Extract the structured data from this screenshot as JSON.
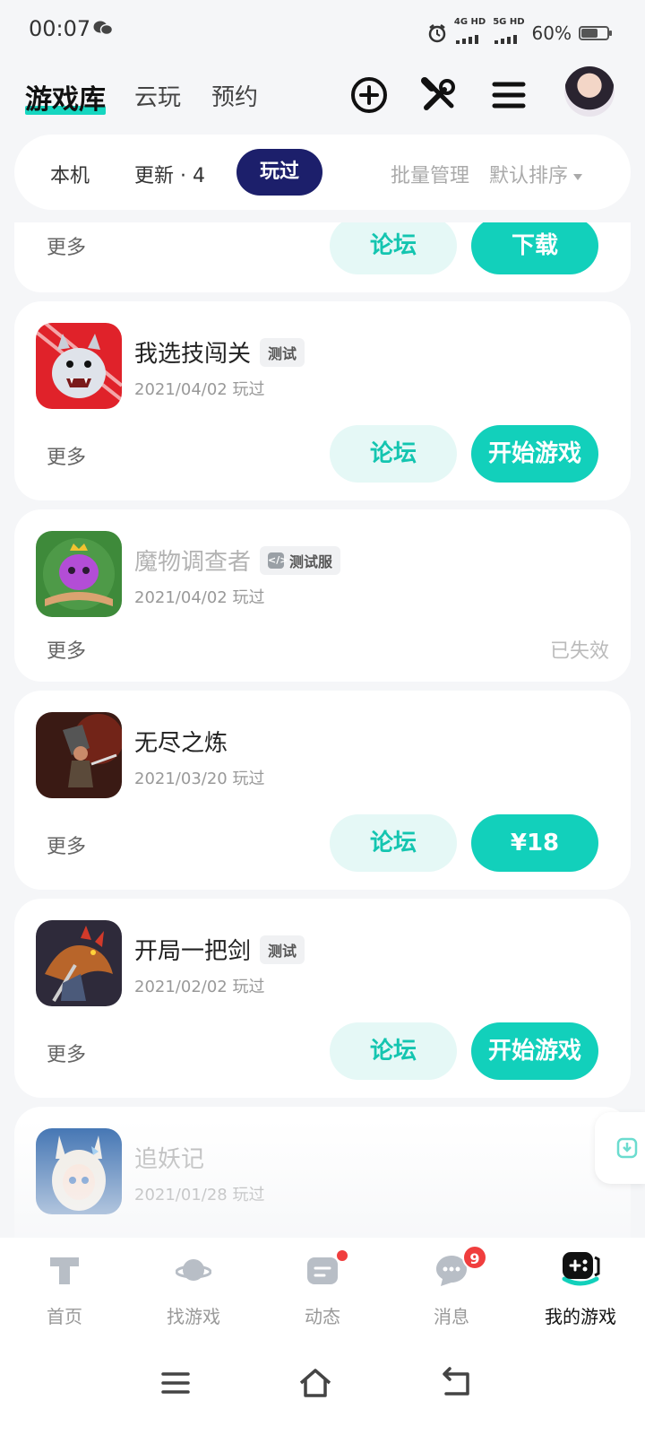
{
  "status_bar": {
    "time": "00:07",
    "net1": "4G HD",
    "net2": "5G HD",
    "battery_text": "60%",
    "battery_level": 0.6
  },
  "header": {
    "title": "游戏库",
    "tabs": [
      "云玩",
      "预约"
    ]
  },
  "filter": {
    "tabs": [
      "本机",
      "更新 · 4",
      "玩过"
    ],
    "active_tab": "玩过",
    "batch_label": "批量管理",
    "sort_label": "默认排序"
  },
  "cards": [
    {
      "more": "更多",
      "forum": "论坛",
      "action": "下载"
    },
    {
      "name": "我选技闯关",
      "tag": "测试",
      "date": "2021/04/02 玩过",
      "more": "更多",
      "forum": "论坛",
      "action": "开始游戏"
    },
    {
      "name": "魔物调查者",
      "tag": "测试服",
      "date": "2021/04/02 玩过",
      "more": "更多",
      "status": "已失效"
    },
    {
      "name": "无尽之炼",
      "date": "2021/03/20 玩过",
      "more": "更多",
      "forum": "论坛",
      "action": "¥18"
    },
    {
      "name": "开局一把剑",
      "tag": "测试",
      "date": "2021/02/02 玩过",
      "more": "更多",
      "forum": "论坛",
      "action": "开始游戏"
    },
    {
      "name": "追妖记",
      "date": "2021/01/28 玩过"
    }
  ],
  "bottom_nav": {
    "items": [
      "首页",
      "找游戏",
      "动态",
      "消息",
      "我的游戏"
    ],
    "active": "我的游戏",
    "message_badge": "9"
  },
  "colors": {
    "accent": "#12d0bb",
    "accent_light": "#e5f8f6",
    "pill": "#1c1f6b",
    "badge": "#f03e3e"
  }
}
